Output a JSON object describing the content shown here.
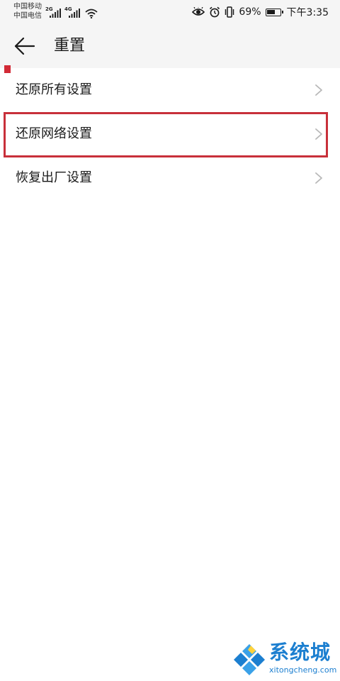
{
  "status_bar": {
    "carrier_1": "中国移动",
    "carrier_2": "中国电信",
    "sim1_network": "2G",
    "sim2_network": "4G",
    "battery_percent_text": "69%",
    "battery_level": 0.69,
    "time": "下午3:35",
    "icons": [
      "signal-icon",
      "wifi-icon",
      "eye-icon",
      "alarm-icon",
      "vibrate-icon",
      "battery-icon"
    ]
  },
  "header": {
    "back_icon": "back-arrow-icon",
    "title": "重置"
  },
  "list": {
    "items": [
      {
        "label": "还原所有设置",
        "icon": "chevron-right-icon"
      },
      {
        "label": "还原网络设置",
        "icon": "chevron-right-icon",
        "highlighted": true
      },
      {
        "label": "恢复出厂设置",
        "icon": "chevron-right-icon"
      }
    ]
  },
  "colors": {
    "highlight": "#c8303a",
    "header_background": "#f5f5f5",
    "text": "#1a1a1a",
    "chevron": "#b8b8b8",
    "watermark": "#1c7fd0"
  },
  "watermark": {
    "name": "系统城",
    "url": "xitongcheng.com"
  }
}
